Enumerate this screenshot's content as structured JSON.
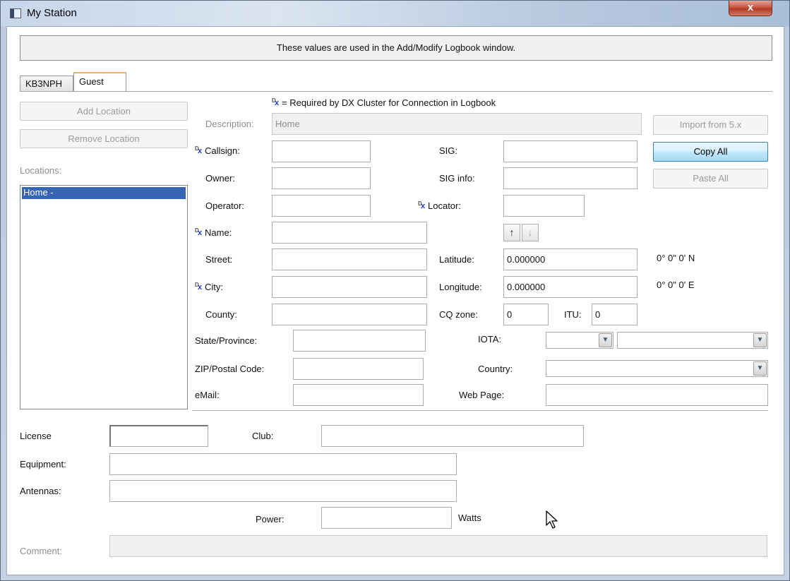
{
  "window": {
    "title": "My Station",
    "close_label": "x"
  },
  "info": "These values are used in the Add/Modify Logbook window.",
  "tabs": [
    {
      "label": "KB3NPH"
    },
    {
      "label": "Guest"
    }
  ],
  "required_note": "= Required by DX Cluster for Connection in Logbook",
  "left": {
    "add_location": "Add Location",
    "remove_location": "Remove Location",
    "locations_label": "Locations:",
    "locations": [
      "Home -"
    ]
  },
  "right_buttons": {
    "import": "Import from 5.x",
    "copy_all": "Copy All",
    "paste_all": "Paste All"
  },
  "form": {
    "description_label": "Description:",
    "description_value": "Home",
    "callsign_label": "Callsign:",
    "callsign_value": "",
    "owner_label": "Owner:",
    "owner_value": "",
    "operator_label": "Operator:",
    "operator_value": "",
    "name_label": "Name:",
    "name_value": "",
    "street_label": "Street:",
    "street_value": "",
    "city_label": "City:",
    "city_value": "",
    "county_label": "County:",
    "county_value": "",
    "state_label": "State/Province:",
    "state_value": "",
    "zip_label": "ZIP/Postal Code:",
    "zip_value": "",
    "email_label": "eMail:",
    "email_value": "",
    "sig_label": "SIG:",
    "sig_value": "",
    "sig_info_label": "SIG info:",
    "sig_info_value": "",
    "locator_label": "Locator:",
    "locator_value": "",
    "latitude_label": "Latitude:",
    "latitude_value": "0.000000",
    "latitude_dms": "0° 0\" 0' N",
    "longitude_label": "Longitude:",
    "longitude_value": "0.000000",
    "longitude_dms": "0° 0\" 0' E",
    "cq_zone_label": "CQ zone:",
    "cq_zone_value": "0",
    "itu_label": "ITU:",
    "itu_value": "0",
    "iota_label": "IOTA:",
    "country_label": "Country:",
    "web_page_label": "Web Page:",
    "web_page_value": ""
  },
  "bottom": {
    "license_label": "License",
    "license_value": "",
    "club_label": "Club:",
    "club_value": "",
    "equipment_label": "Equipment:",
    "equipment_value": "",
    "antennas_label": "Antennas:",
    "antennas_value": "",
    "power_label": "Power:",
    "power_value": "",
    "watts_label": "Watts",
    "comment_label": "Comment:",
    "comment_value": ""
  },
  "colors": {
    "selection": "#3664b4",
    "active_tab_accent": "#f2b25a",
    "button_border": "#3c7fb1"
  },
  "icons": {
    "up": "arrow-up-icon",
    "down": "arrow-down-icon",
    "required": "dx-cluster-icon"
  }
}
